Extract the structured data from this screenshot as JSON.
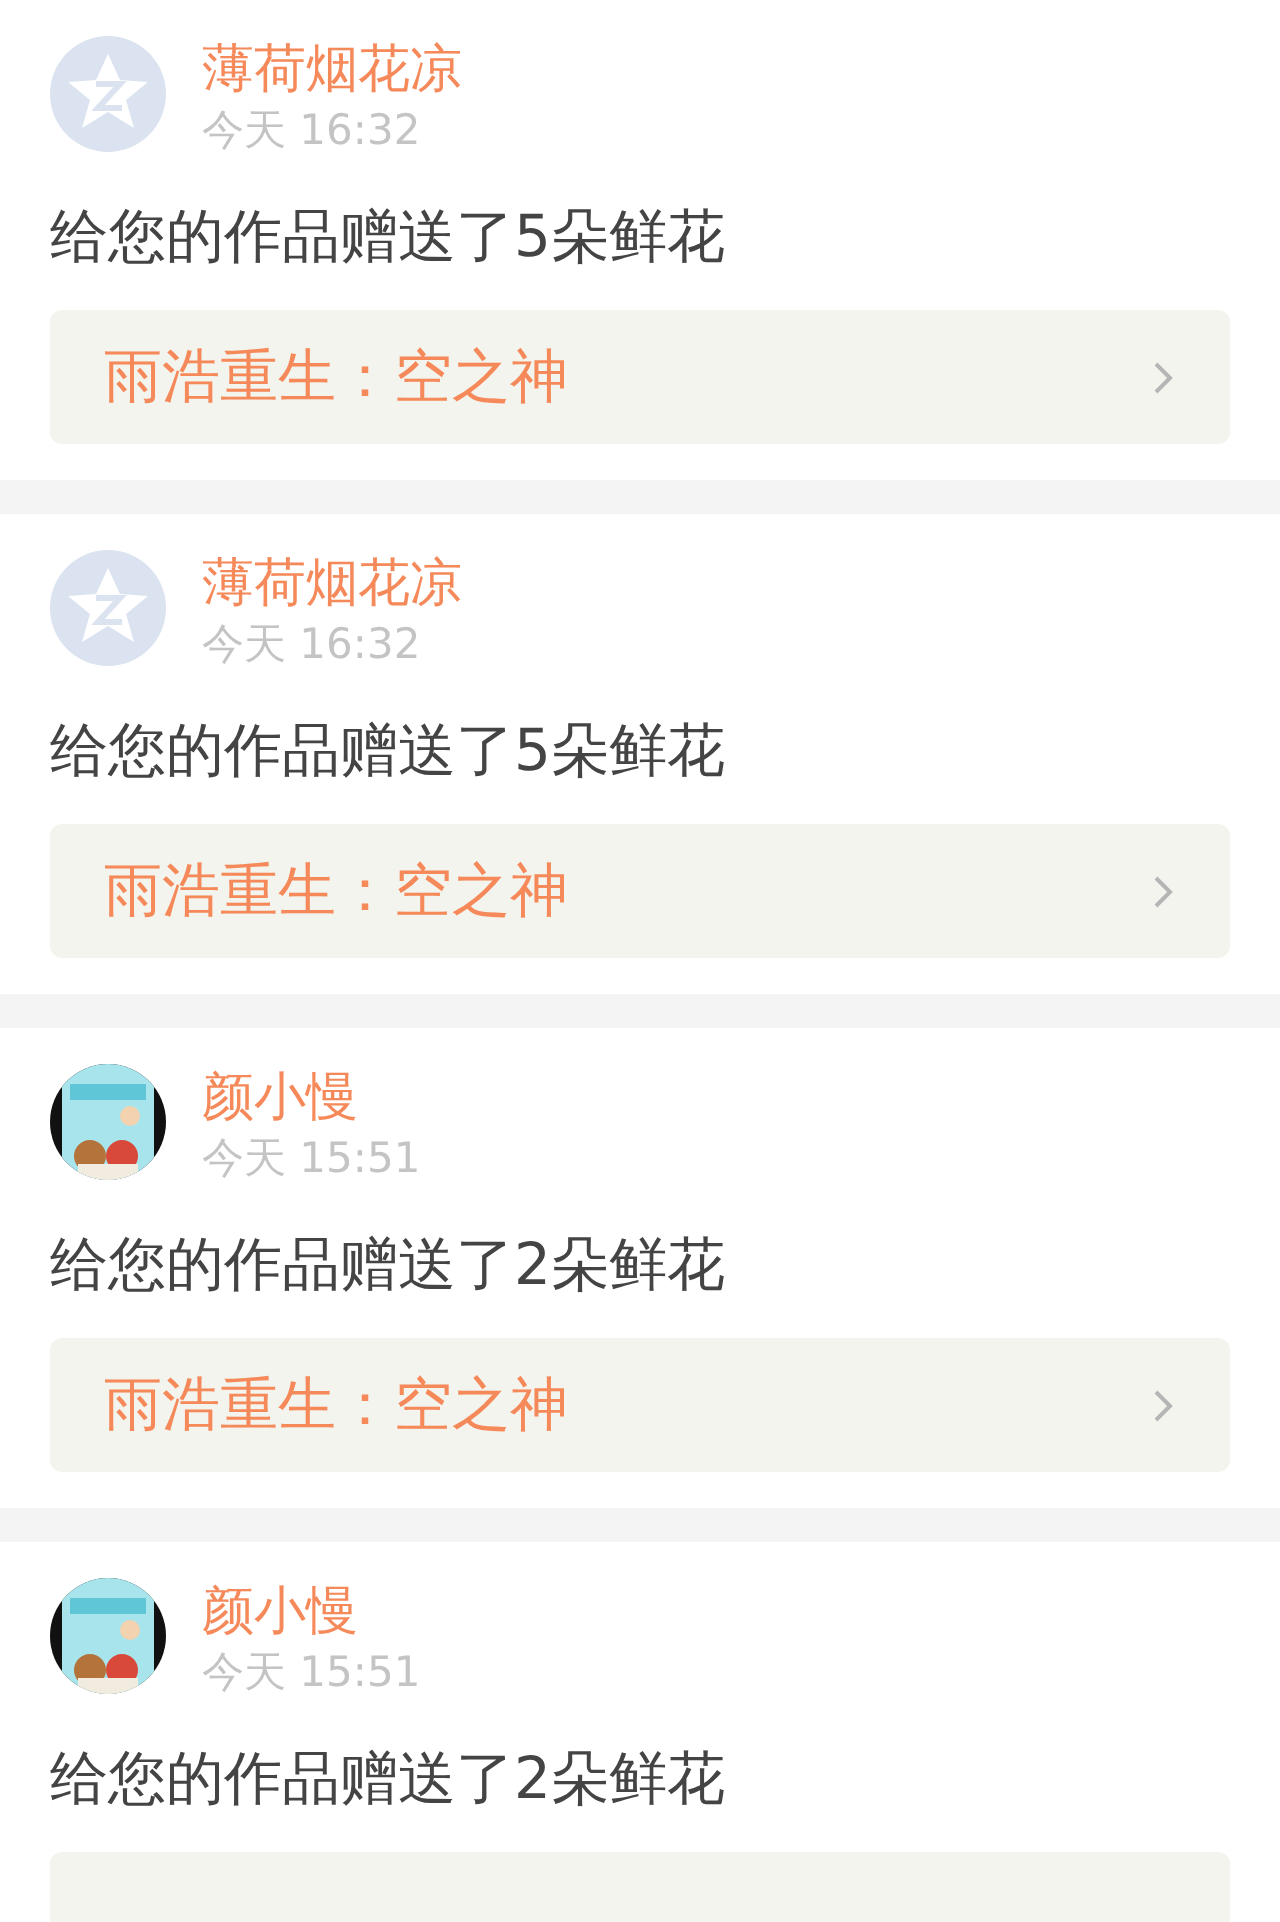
{
  "notifications": [
    {
      "avatar": {
        "kind": "default"
      },
      "name": "薄荷烟花凉",
      "time": "今天 16:32",
      "message": "给您的作品赠送了5朵鲜花",
      "link": "雨浩重生：空之神"
    },
    {
      "avatar": {
        "kind": "default"
      },
      "name": "薄荷烟花凉",
      "time": "今天 16:32",
      "message": "给您的作品赠送了5朵鲜花",
      "link": "雨浩重生：空之神"
    },
    {
      "name": "颜小慢",
      "time": "今天 15:51",
      "message": "给您的作品赠送了2朵鲜花",
      "link": "雨浩重生：空之神"
    },
    {
      "name": "颜小慢",
      "time": "今天 15:51",
      "message": "给您的作品赠送了2朵鲜花"
    }
  ]
}
